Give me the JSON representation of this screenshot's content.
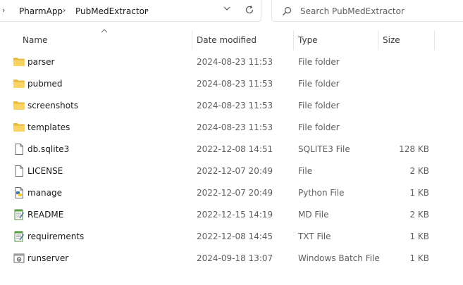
{
  "address": {
    "breadcrumbs": [
      "PharmApp",
      "PubMedExtractor"
    ],
    "separator": "›"
  },
  "search": {
    "placeholder": "Search PubMedExtractor"
  },
  "columns": {
    "name": "Name",
    "date": "Date modified",
    "type": "Type",
    "size": "Size"
  },
  "files": [
    {
      "name": "parser",
      "date": "2024-08-23 11:53",
      "type": "File folder",
      "size": "",
      "icon": "folder-icon"
    },
    {
      "name": "pubmed",
      "date": "2024-08-23 11:53",
      "type": "File folder",
      "size": "",
      "icon": "folder-icon"
    },
    {
      "name": "screenshots",
      "date": "2024-08-23 11:53",
      "type": "File folder",
      "size": "",
      "icon": "folder-icon"
    },
    {
      "name": "templates",
      "date": "2024-08-23 11:53",
      "type": "File folder",
      "size": "",
      "icon": "folder-icon"
    },
    {
      "name": "db.sqlite3",
      "date": "2022-12-08 14:51",
      "type": "SQLITE3 File",
      "size": "128 KB",
      "icon": "file-icon"
    },
    {
      "name": "LICENSE",
      "date": "2022-12-07 20:49",
      "type": "File",
      "size": "2 KB",
      "icon": "file-icon"
    },
    {
      "name": "manage",
      "date": "2022-12-07 20:49",
      "type": "Python File",
      "size": "1 KB",
      "icon": "python-file-icon"
    },
    {
      "name": "README",
      "date": "2022-12-15 14:19",
      "type": "MD File",
      "size": "2 KB",
      "icon": "notepad-file-icon"
    },
    {
      "name": "requirements",
      "date": "2022-12-08 14:45",
      "type": "TXT File",
      "size": "1 KB",
      "icon": "notepad-file-icon"
    },
    {
      "name": "runserver",
      "date": "2024-09-18 13:07",
      "type": "Windows Batch File",
      "size": "1 KB",
      "icon": "batch-file-icon"
    }
  ]
}
